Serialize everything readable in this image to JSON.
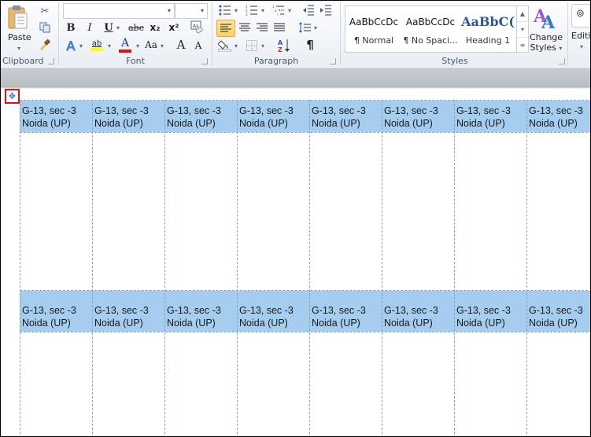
{
  "ribbon": {
    "clipboard": {
      "label": "Clipboard",
      "paste_label": "Paste",
      "icons": [
        "paste-icon",
        "cut-icon",
        "copy-icon",
        "format-painter-icon"
      ]
    },
    "font": {
      "label": "Font",
      "font_name_value": "",
      "font_size_value": "",
      "buttons": [
        "bold",
        "italic",
        "underline",
        "strikethrough",
        "subscript",
        "superscript",
        "clear-formatting",
        "text-effects",
        "highlight",
        "font-color",
        "change-case",
        "grow-font",
        "shrink-font"
      ],
      "glyphs": {
        "bold": "B",
        "italic": "I",
        "underline": "U",
        "strikethrough": "abc",
        "subscript": "x₂",
        "superscript": "x²",
        "text_effects": "A",
        "highlight": "ab",
        "font_color": "A",
        "change_case": "Aa",
        "grow_font": "A",
        "shrink_font": "A"
      },
      "colors": {
        "highlight": "#ffff00",
        "font_color": "#e01010"
      }
    },
    "paragraph": {
      "label": "Paragraph",
      "active_alignment": "align-left",
      "glyphs": {
        "pilcrow": "¶",
        "sort": "A↓Z"
      }
    },
    "styles": {
      "label": "Styles",
      "items": [
        {
          "sample": "AaBbCcDc",
          "name": "¶ Normal"
        },
        {
          "sample": "AaBbCcDc",
          "name": "¶ No Spaci..."
        },
        {
          "sample": "AaBbC(",
          "name": "Heading 1"
        }
      ],
      "change_styles_label_1": "Change",
      "change_styles_label_2": "Styles"
    },
    "editing": {
      "label": "Editi"
    }
  },
  "document": {
    "table_move_handle_glyph": "✥",
    "label_line1": "G-13, sec -3",
    "label_line2": "Noida (UP)",
    "rows": [
      {
        "cells": [
          {
            "line1": "G-13, sec -3",
            "line2": "Noida (UP)"
          },
          {
            "line1": "G-13, sec -3",
            "line2": "Noida (UP)"
          },
          {
            "line1": "G-13, sec -3",
            "line2": "Noida (UP)"
          },
          {
            "line1": "G-13, sec -3",
            "line2": "Noida (UP)"
          },
          {
            "line1": "G-13, sec -3",
            "line2": "Noida (UP)"
          },
          {
            "line1": "G-13, sec -3",
            "line2": "Noida (UP)"
          },
          {
            "line1": "G-13, sec -3",
            "line2": "Noida (UP)"
          },
          {
            "line1": "G-13, sec -3",
            "line2": "Noida (UP)"
          }
        ]
      },
      {
        "cells": [
          {
            "line1": "G-13, sec -3",
            "line2": "Noida (UP)"
          },
          {
            "line1": "G-13, sec -3",
            "line2": "Noida (UP)"
          },
          {
            "line1": "G-13, sec -3",
            "line2": "Noida (UP)"
          },
          {
            "line1": "G-13, sec -3",
            "line2": "Noida (UP)"
          },
          {
            "line1": "G-13, sec -3",
            "line2": "Noida (UP)"
          },
          {
            "line1": "G-13, sec -3",
            "line2": "Noida (UP)"
          },
          {
            "line1": "G-13, sec -3",
            "line2": "Noida (UP)"
          },
          {
            "line1": "G-13, sec -3",
            "line2": "Noida (UP)"
          }
        ]
      }
    ],
    "colors": {
      "label_highlight": "#a4cdf0",
      "gridline": "#8aa0bb",
      "move_handle_border": "#e01010"
    }
  }
}
